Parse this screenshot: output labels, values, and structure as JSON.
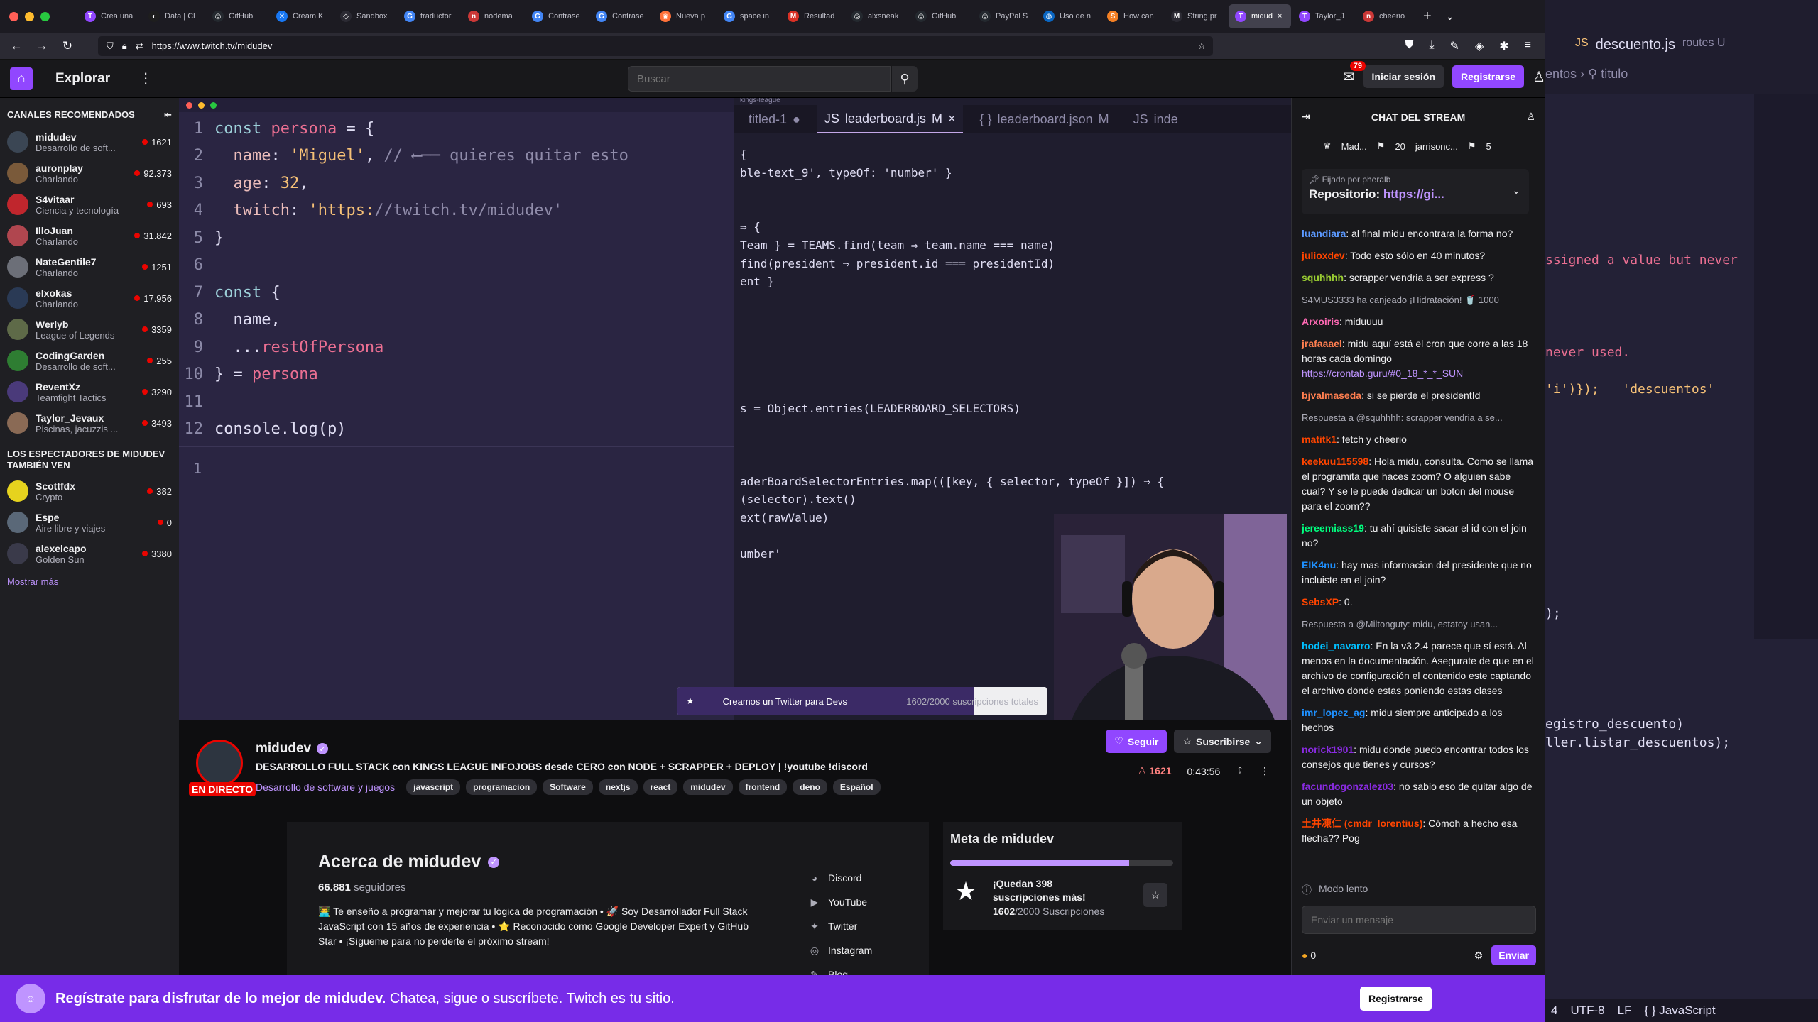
{
  "browser": {
    "tabs": [
      {
        "label": "Crea una",
        "color": "#9147ff",
        "glyph": "T"
      },
      {
        "label": "Data | Cl",
        "color": "#1e1e1e",
        "glyph": "◐"
      },
      {
        "label": "GitHub",
        "color": "#24292f",
        "glyph": "◎"
      },
      {
        "label": "Cream K",
        "color": "#1877f2",
        "glyph": "✕"
      },
      {
        "label": "Sandbox",
        "color": "#2b2a33",
        "glyph": "◇"
      },
      {
        "label": "traductor",
        "color": "#4285f4",
        "glyph": "G"
      },
      {
        "label": "nodema",
        "color": "#cb3837",
        "glyph": "n"
      },
      {
        "label": "Contrase",
        "color": "#4285f4",
        "glyph": "G"
      },
      {
        "label": "Contrase",
        "color": "#4285f4",
        "glyph": "G"
      },
      {
        "label": "Nueva p",
        "color": "#ff7139",
        "glyph": "◉"
      },
      {
        "label": "space in",
        "color": "#4285f4",
        "glyph": "G"
      },
      {
        "label": "Resultad",
        "color": "#d93025",
        "glyph": "M"
      },
      {
        "label": "alxsneak",
        "color": "#24292f",
        "glyph": "◎"
      },
      {
        "label": "GitHub",
        "color": "#24292f",
        "glyph": "◎"
      },
      {
        "label": "PayPal S",
        "color": "#24292f",
        "glyph": "◎"
      },
      {
        "label": "Uso de n",
        "color": "#0a66c2",
        "glyph": "◍"
      },
      {
        "label": "How can",
        "color": "#f48024",
        "glyph": "S"
      },
      {
        "label": "String.pr",
        "color": "#2b2a33",
        "glyph": "M"
      },
      {
        "label": "midud",
        "color": "#9147ff",
        "glyph": "T"
      },
      {
        "label": "Taylor_J",
        "color": "#9147ff",
        "glyph": "T"
      },
      {
        "label": "cheerio",
        "color": "#cb3837",
        "glyph": "n"
      }
    ],
    "url": "https://www.twitch.tv/midudev"
  },
  "nav": {
    "explore": "Explorar",
    "search_placeholder": "Buscar",
    "notif_count": "79",
    "login": "Iniciar sesión",
    "register": "Registrarse"
  },
  "sidebar": {
    "recommended_title": "CANALES RECOMENDADOS",
    "channels": [
      {
        "name": "midudev",
        "cat": "Desarrollo de soft...",
        "viewers": "1621",
        "color": "#3b4654"
      },
      {
        "name": "auronplay",
        "cat": "Charlando",
        "viewers": "92.373",
        "color": "#7a5a3a"
      },
      {
        "name": "S4vitaar",
        "cat": "Ciencia y tecnología",
        "viewers": "693",
        "color": "#c0262d"
      },
      {
        "name": "IlloJuan",
        "cat": "Charlando",
        "viewers": "31.842",
        "color": "#b0464f"
      },
      {
        "name": "NateGentile7",
        "cat": "Charlando",
        "viewers": "1251",
        "color": "#6c6f78"
      },
      {
        "name": "elxokas",
        "cat": "Charlando",
        "viewers": "17.956",
        "color": "#2a3a55"
      },
      {
        "name": "Werlyb",
        "cat": "League of Legends",
        "viewers": "3359",
        "color": "#5e6a48"
      },
      {
        "name": "CodingGarden",
        "cat": "Desarrollo de soft...",
        "viewers": "255",
        "color": "#2e7d32"
      },
      {
        "name": "ReventXz",
        "cat": "Teamfight Tactics",
        "viewers": "3290",
        "color": "#4a3a7a"
      },
      {
        "name": "Taylor_Jevaux",
        "cat": "Piscinas, jacuzzis ...",
        "viewers": "3493",
        "color": "#8a6a55"
      }
    ],
    "viewers_also_title": "LOS ESPECTADORES DE MIDUDEV TAMBIÉN VEN",
    "also": [
      {
        "name": "Scottfdx",
        "cat": "Crypto",
        "viewers": "382",
        "color": "#e6d31e"
      },
      {
        "name": "Espe",
        "cat": "Aire libre y viajes",
        "viewers": "0",
        "color": "#5a6878"
      },
      {
        "name": "alexelcapo",
        "cat": "Golden Sun",
        "viewers": "3380",
        "color": "#3a3a4a"
      }
    ],
    "show_more": "Mostrar más"
  },
  "stream": {
    "left_code": [
      {
        "n": "1",
        "t": "const persona = {"
      },
      {
        "n": "2",
        "t": "  name: 'Miguel', // ⟵── quieres quitar esto"
      },
      {
        "n": "3",
        "t": "  age: 32,"
      },
      {
        "n": "4",
        "t": "  twitch: 'https://twitch.tv/midudev'"
      },
      {
        "n": "5",
        "t": "}"
      },
      {
        "n": "6",
        "t": ""
      },
      {
        "n": "7",
        "t": "const {"
      },
      {
        "n": "8",
        "t": "  name,"
      },
      {
        "n": "9",
        "t": "  ...restOfPersona"
      },
      {
        "n": "10",
        "t": "} = persona"
      },
      {
        "n": "11",
        "t": ""
      },
      {
        "n": "12",
        "t": "console.log(p)"
      }
    ],
    "terminal_line": "1",
    "right_tabs": [
      {
        "label": "titled-1",
        "mod": "●"
      },
      {
        "label": "leaderboard.js",
        "mod": "M"
      },
      {
        "label": "leaderboard.json",
        "mod": "M"
      },
      {
        "label": "inde",
        "mod": ""
      }
    ],
    "kings_league": "kings-league",
    "right_code": [
      "{",
      "ble-text_9', typeOf: 'number' }",
      "",
      "",
      "⇒ {",
      "Team } = TEAMS.find(team ⇒ team.name === name)",
      "find(president ⇒ president.id === presidentId)",
      "ent }",
      "",
      "",
      "",
      "",
      "",
      "",
      "s = Object.entries(LEADERBOARD_SELECTORS)",
      "",
      "",
      "",
      "aderBoardSelectorEntries.map(([key, { selector, typeOf }]) ⇒ {",
      "(selector).text()",
      "ext(rawValue)",
      "",
      "umber'"
    ],
    "goal_banner_text": "Creamos un Twitter para Devs",
    "goal_banner_count": "1602/2000 suscripciones totales",
    "goal_banner_fraction": 0.801
  },
  "channel": {
    "live_label": "EN DIRECTO",
    "name": "midudev",
    "title": "DESARROLLO FULL STACK con KINGS LEAGUE INFOJOBS desde CERO con NODE + SCRAPPER + DEPLOY | !youtube !discord",
    "category": "Desarrollo de software y juegos",
    "tags": [
      "javascript",
      "programacion",
      "Software",
      "nextjs",
      "react",
      "midudev",
      "frontend",
      "deno",
      "Español"
    ],
    "follow": "Seguir",
    "subscribe": "Suscribirse",
    "viewers": "1621",
    "uptime": "0:43:56"
  },
  "about": {
    "title": "Acerca de midudev",
    "followers_count": "66.881",
    "followers_label": "seguidores",
    "description": "👨‍💻 Te enseño a programar y mejorar tu lógica de programación • 🚀 Soy Desarrollador Full Stack JavaScript con 15 años de experiencia • ⭐ Reconocido como Google Developer Expert y GitHub Star • ¡Sígueme para no perderte el próximo stream!",
    "social": [
      {
        "icon": "discord-icon",
        "glyph": "◕",
        "label": "Discord"
      },
      {
        "icon": "youtube-icon",
        "glyph": "▶",
        "label": "YouTube"
      },
      {
        "icon": "twitter-icon",
        "glyph": "✦",
        "label": "Twitter"
      },
      {
        "icon": "instagram-icon",
        "glyph": "◎",
        "label": "Instagram"
      },
      {
        "icon": "blog-icon",
        "glyph": "✎",
        "label": "Blog"
      }
    ]
  },
  "goal": {
    "title": "Meta de midudev",
    "headline": "¡Quedan 398 suscripciones más!",
    "progress_current": "1602",
    "progress_total": "/2000 Suscripciones",
    "fraction": 0.801
  },
  "chat": {
    "title": "CHAT DEL STREAM",
    "gifters": [
      "Mad...",
      "20",
      "jarrisonc...",
      "5"
    ],
    "pinned_by": "Fijado por",
    "pinned_user": "pheralb",
    "pinned_text": "Repositorio:",
    "pinned_link": "https://gi...",
    "messages": [
      {
        "user": "luandiara",
        "color": "#5b99ff",
        "text": ": al final midu encontrara la forma no?"
      },
      {
        "user": "julioxdev",
        "color": "#ff4500",
        "text": ": Todo esto sólo en 40 minutos?"
      },
      {
        "user": "squhhhh",
        "color": "#9acd32",
        "text": ": scrapper vendria a ser express ?"
      },
      {
        "user": "",
        "color": "#adadb8",
        "text": "S4MUS3333 ha canjeado ¡Hidratación! 🥤 1000",
        "sys": true
      },
      {
        "user": "Arxoiris",
        "color": "#ff69b4",
        "text": ": miduuuu"
      },
      {
        "user": "jrafaaael",
        "color": "#ff7f50",
        "text": ": midu aquí está el cron que corre a las 18 horas cada domingo ",
        "link": "https://crontab.guru/#0_18_*_*_SUN"
      },
      {
        "user": "bjvalmaseda",
        "color": "#ff7f50",
        "text": ": si se pierde el presidentId"
      },
      {
        "user": "",
        "color": "#adadb8",
        "text": "Respuesta a @squhhhh: scrapper vendria a se...",
        "sys": true
      },
      {
        "user": "matitk1",
        "color": "#ff4500",
        "text": ": fetch y cheerio"
      },
      {
        "user": "keekuu115598",
        "color": "#ff4500",
        "text": ": Hola midu, consulta. Como se llama el programita que haces zoom? O alguien sabe cual? Y se le puede dedicar un boton del mouse para el zoom??"
      },
      {
        "user": "jereemiass19",
        "color": "#00ff7f",
        "text": ": tu ahí quisiste sacar el id con el join no?"
      },
      {
        "user": "EIK4nu",
        "color": "#1e90ff",
        "text": ": hay mas informacion del presidente que no incluiste en el join?"
      },
      {
        "user": "SebsXP",
        "color": "#ff4500",
        "text": ": 0."
      },
      {
        "user": "",
        "color": "#adadb8",
        "text": "Respuesta a @Miltonguty: midu, estatoy usan...",
        "sys": true
      },
      {
        "user": "hodei_navarro",
        "color": "#00bfff",
        "text": ": En la v3.2.4 parece que sí está. Al menos en la documentación. Asegurate de que en el archivo de configuración el contenido este captando el archivo donde estas poniendo estas clases"
      },
      {
        "user": "imr_lopez_ag",
        "color": "#1e90ff",
        "text": ": midu siempre anticipado a los hechos"
      },
      {
        "user": "norick1901",
        "color": "#8a2be2",
        "text": ": midu donde puedo encontrar todos los consejos que tienes y cursos?"
      },
      {
        "user": "facundogonzalez03",
        "color": "#8a2be2",
        "text": ": no sabio eso de quitar algo de un objeto"
      },
      {
        "user": "土井凍仁 (cmdr_lorentius)",
        "color": "#ff4500",
        "text": ": Cómoh a hecho esa flecha?? Pog"
      }
    ],
    "slow_mode": "Modo lento",
    "input_placeholder": "Enviar un mensaje",
    "points": "0",
    "send": "Enviar"
  },
  "banner": {
    "bold": "Regístrate para disfrutar de lo mejor de midudev.",
    "rest": " Chatea, sigue o suscríbete. Twitch es tu sitio.",
    "button": "Registrarse"
  },
  "vscode_bg": {
    "file": "descuento.js",
    "folder": "routes U",
    "crumb": "entos › ⚲ titulo",
    "lines": [
      {
        "t": "ssigned a value but never",
        "c": "#eb6f92"
      },
      {
        "t": "never used.",
        "c": "#eb6f92"
      },
      {
        "t": "'i')});   'descuentos'",
        "c": "#f6c177"
      },
      {
        "t": ");",
        "c": "#e0def4"
      },
      {
        "t": "egistro_descuento)",
        "c": "#e0def4"
      },
      {
        "t": "ller.listar_descuentos);",
        "c": "#e0def4"
      }
    ],
    "status": [
      "4",
      "UTF-8",
      "LF",
      "{ } JavaScript"
    ]
  }
}
